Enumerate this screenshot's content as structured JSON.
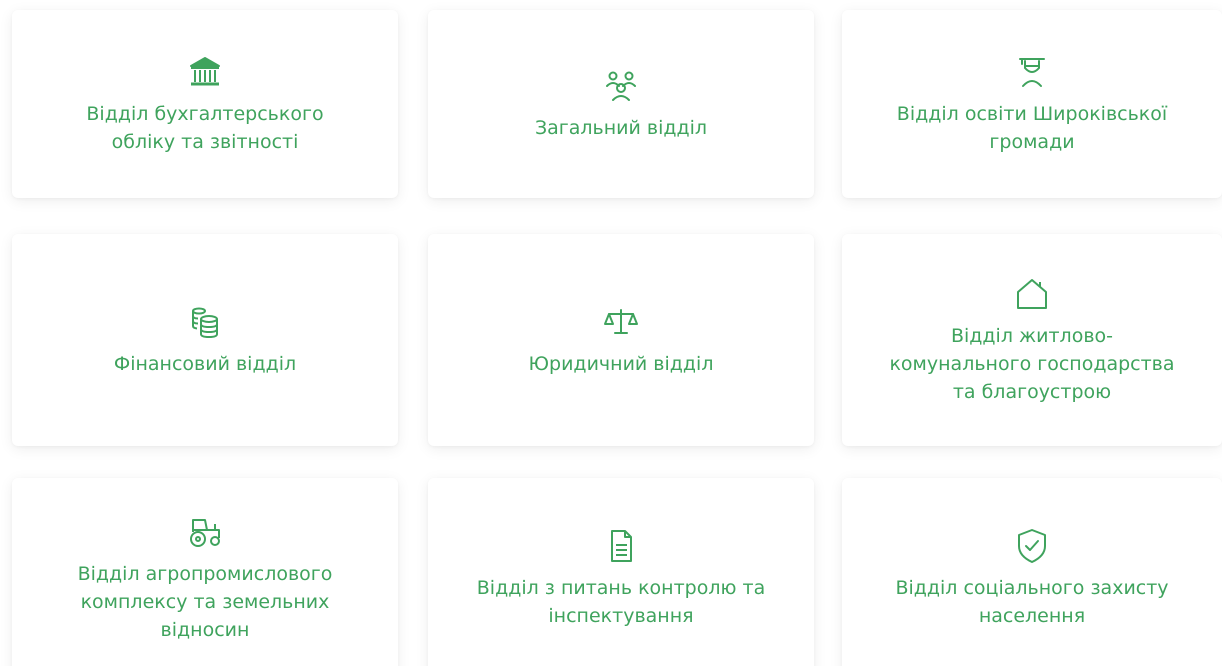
{
  "departments": [
    {
      "label": "Відділ бухгалтерського\nобліку та звітності",
      "icon": "bank-building-icon"
    },
    {
      "label": "Загальний відділ",
      "icon": "people-group-icon"
    },
    {
      "label": "Відділ освіти Широківської\nгромади",
      "icon": "graduate-student-icon"
    },
    {
      "label": "Фінансовий відділ",
      "icon": "coins-stack-icon"
    },
    {
      "label": "Юридичний відділ",
      "icon": "scales-of-justice-icon"
    },
    {
      "label": "Відділ житлово-\nкомунального господарства\nта благоустрою",
      "icon": "house-icon"
    },
    {
      "label": "Відділ агропромислового\nкомплексу та земельних\nвідносин",
      "icon": "tractor-icon"
    },
    {
      "label": "Відділ з питань контролю та\nінспектування",
      "icon": "document-icon"
    },
    {
      "label": "Відділ соціального захисту\nнаселення",
      "icon": "shield-check-icon"
    }
  ],
  "colors": {
    "accent": "#3fa35d",
    "card_background": "#ffffff"
  }
}
